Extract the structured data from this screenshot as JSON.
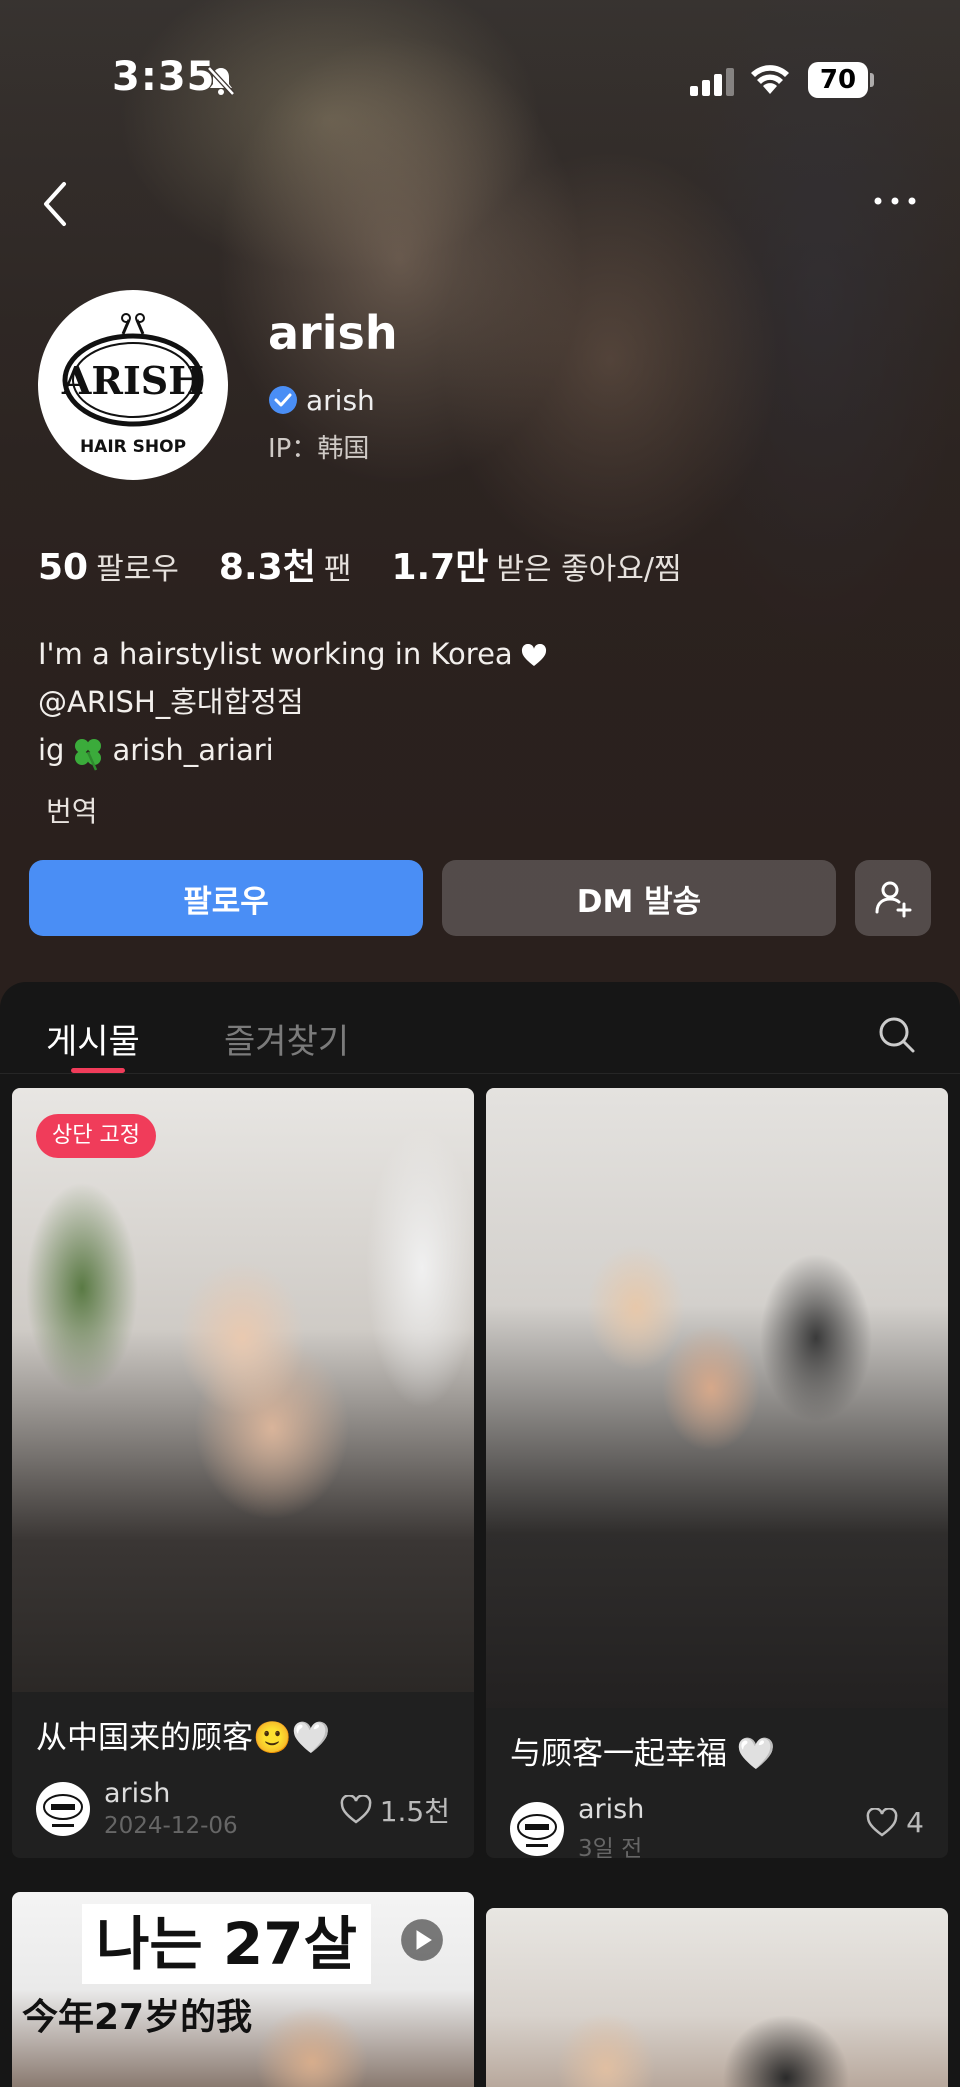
{
  "status_bar": {
    "time": "3:35",
    "battery": "70"
  },
  "profile": {
    "name": "arish",
    "verified_name": "arish",
    "ip": "IP：韩国",
    "logo_text": "ARISH",
    "logo_sub": "HAIR SHOP",
    "stats": [
      {
        "value": "50",
        "label": "팔로우"
      },
      {
        "value": "8.3천",
        "label": "팬"
      },
      {
        "value": "1.7만",
        "label": "받은 좋아요/찜"
      }
    ],
    "bio": {
      "line1": "I'm a hairstylist working in Korea",
      "line2": "@ARISH_홍대합정점",
      "line3_prefix": "ig",
      "line3_handle": "arish_ariari"
    },
    "translate": "번역"
  },
  "buttons": {
    "follow": "팔로우",
    "dm": "DM 발송"
  },
  "tabs": [
    {
      "label": "게시물"
    },
    {
      "label": "즐겨찾기"
    }
  ],
  "posts": [
    {
      "badge": "상단 고정",
      "caption": "从中国来的顾客🙂🤍",
      "author": "arish",
      "date": "2024-12-06",
      "likes": "1.5천"
    },
    {
      "caption": "与顾客一起幸福 🤍",
      "author": "arish",
      "date": "3일 전",
      "likes": "4"
    },
    {
      "overlay_title": "나는 27살",
      "overlay_sub": "今年27岁的我"
    },
    {}
  ],
  "colors": {
    "accent": "#4a8ef5",
    "pink": "#f03c5a",
    "verified": "#4a8ef5"
  }
}
